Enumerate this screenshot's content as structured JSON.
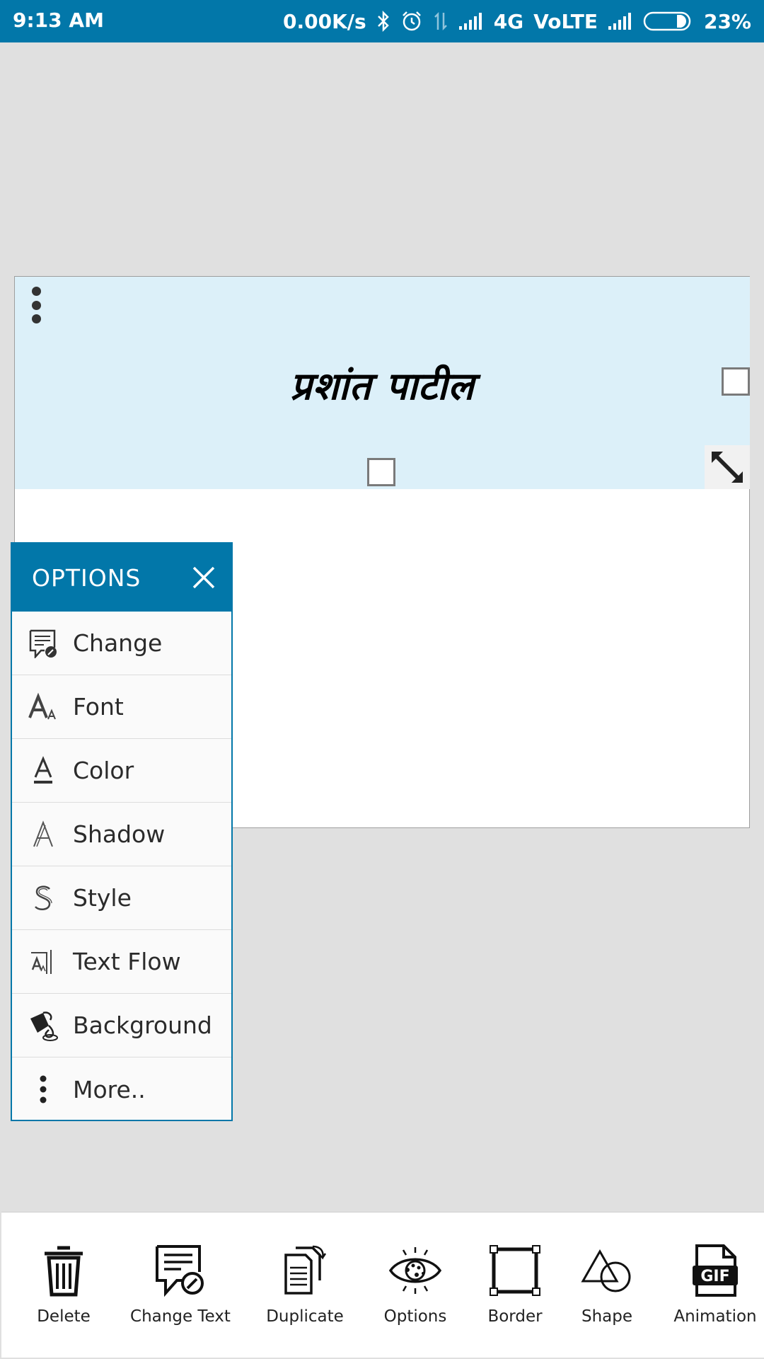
{
  "status_bar": {
    "time": "9:13 AM",
    "net_speed": "0.00K/s",
    "network": "4G",
    "volte": "VoLTE",
    "battery": "23%"
  },
  "canvas": {
    "text": "प्रशांत पाटील"
  },
  "options": {
    "title": "OPTIONS",
    "items": [
      {
        "label": "Change",
        "icon": "change-text-icon"
      },
      {
        "label": "Font",
        "icon": "font-icon"
      },
      {
        "label": "Color",
        "icon": "text-color-icon"
      },
      {
        "label": "Shadow",
        "icon": "shadow-icon"
      },
      {
        "label": "Style",
        "icon": "style-icon"
      },
      {
        "label": "Text Flow",
        "icon": "text-flow-icon"
      },
      {
        "label": "Background",
        "icon": "paint-bucket-icon"
      },
      {
        "label": "More..",
        "icon": "more-vertical-icon"
      }
    ]
  },
  "toolbar": {
    "items": [
      {
        "label": "Delete",
        "icon": "trash-icon"
      },
      {
        "label": "Change Text",
        "icon": "change-text-icon"
      },
      {
        "label": "Duplicate",
        "icon": "duplicate-icon"
      },
      {
        "label": "Options",
        "icon": "options-eye-icon"
      },
      {
        "label": "Border",
        "icon": "border-icon"
      },
      {
        "label": "Shape",
        "icon": "shape-icon"
      },
      {
        "label": "Animation",
        "icon": "gif-icon"
      }
    ]
  },
  "colors": {
    "primary": "#0277a9",
    "selection_bg": "#dcf0f9",
    "background": "#e0e0e0"
  }
}
